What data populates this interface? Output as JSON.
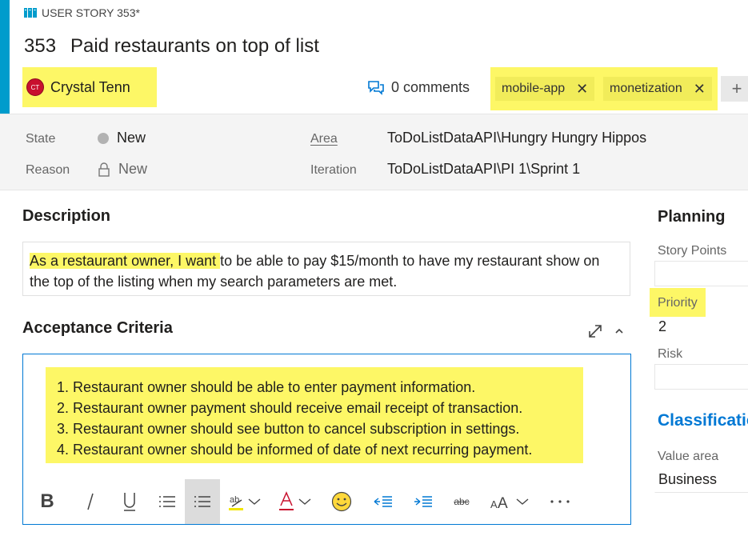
{
  "work_item": {
    "type_label": "USER STORY 353*",
    "id": "353",
    "title": "Paid restaurants on top of list",
    "assignee": {
      "initials": "CT",
      "name": "Crystal Tenn"
    },
    "comments_label": "0 comments",
    "tags": [
      "mobile-app",
      "monetization"
    ],
    "add_tag_symbol": "+"
  },
  "fields": {
    "state_label": "State",
    "state_value": "New",
    "reason_label": "Reason",
    "reason_value": "New",
    "area_label": "Area",
    "area_value": "ToDoListDataAPI\\Hungry Hungry Hippos",
    "iteration_label": "Iteration",
    "iteration_value": "ToDoListDataAPI\\PI 1\\Sprint 1"
  },
  "description": {
    "title": "Description",
    "highlighted": "As a restaurant owner, I want ",
    "rest": "to be able to pay $15/month to have my restaurant show on the top of the listing when my search parameters are met."
  },
  "acceptance": {
    "title": "Acceptance Criteria",
    "items": [
      "1. Restaurant owner should be able to enter payment information.",
      "2. Restaurant owner payment should receive email receipt of transaction.",
      "3. Restaurant owner should see button to cancel subscription in settings.",
      "4. Restaurant owner should be informed of date of next recurring payment."
    ]
  },
  "toolbar": [
    "bold-icon",
    "italic-icon",
    "underline-icon",
    "bullet-list-icon",
    "numbered-list-icon",
    "highlight-icon",
    "font-color-icon",
    "emoji-icon",
    "decrease-indent-icon",
    "increase-indent-icon",
    "strikethrough-icon",
    "font-size-icon",
    "more-icon"
  ],
  "planning": {
    "title": "Planning",
    "story_points_label": "Story Points",
    "story_points_value": "",
    "priority_label": "Priority",
    "priority_value": "2",
    "risk_label": "Risk",
    "risk_value": ""
  },
  "classification": {
    "title": "Classification",
    "value_area_label": "Value area",
    "value_area_value": "Business"
  },
  "colors": {
    "accent": "#009ccc",
    "highlight": "#fdf766",
    "link_blue": "#0078d4",
    "avatar_red": "#c8102e"
  }
}
